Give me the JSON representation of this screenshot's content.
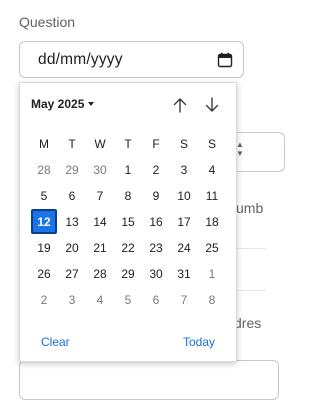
{
  "field": {
    "label": "Question",
    "placeholder": "dd/mm/yyyy",
    "icon": "calendar-icon"
  },
  "background": {
    "partial_label_1": "umb",
    "partial_label_2": "dres"
  },
  "picker": {
    "month_label": "May 2025",
    "prev_icon": "arrow-up-icon",
    "next_icon": "arrow-down-icon",
    "weekdays": [
      "M",
      "T",
      "W",
      "T",
      "F",
      "S",
      "S"
    ],
    "days": [
      {
        "label": "28",
        "other": true
      },
      {
        "label": "29",
        "other": true
      },
      {
        "label": "30",
        "other": true
      },
      {
        "label": "1"
      },
      {
        "label": "2"
      },
      {
        "label": "3"
      },
      {
        "label": "4"
      },
      {
        "label": "5"
      },
      {
        "label": "6"
      },
      {
        "label": "7"
      },
      {
        "label": "8"
      },
      {
        "label": "9"
      },
      {
        "label": "10"
      },
      {
        "label": "11"
      },
      {
        "label": "12",
        "selected": true
      },
      {
        "label": "13"
      },
      {
        "label": "14"
      },
      {
        "label": "15"
      },
      {
        "label": "16"
      },
      {
        "label": "17"
      },
      {
        "label": "18"
      },
      {
        "label": "19"
      },
      {
        "label": "20"
      },
      {
        "label": "21"
      },
      {
        "label": "22"
      },
      {
        "label": "23"
      },
      {
        "label": "24"
      },
      {
        "label": "25"
      },
      {
        "label": "26"
      },
      {
        "label": "27"
      },
      {
        "label": "28"
      },
      {
        "label": "29"
      },
      {
        "label": "30"
      },
      {
        "label": "31"
      },
      {
        "label": "1",
        "other": true
      },
      {
        "label": "2",
        "other": true
      },
      {
        "label": "3",
        "other": true
      },
      {
        "label": "4",
        "other": true
      },
      {
        "label": "5",
        "other": true
      },
      {
        "label": "6",
        "other": true
      },
      {
        "label": "7",
        "other": true
      },
      {
        "label": "8",
        "other": true
      }
    ],
    "clear_label": "Clear",
    "today_label": "Today"
  },
  "colors": {
    "accent": "#1a73e8",
    "link": "#1a6fd8",
    "muted": "#7a7a7a"
  }
}
